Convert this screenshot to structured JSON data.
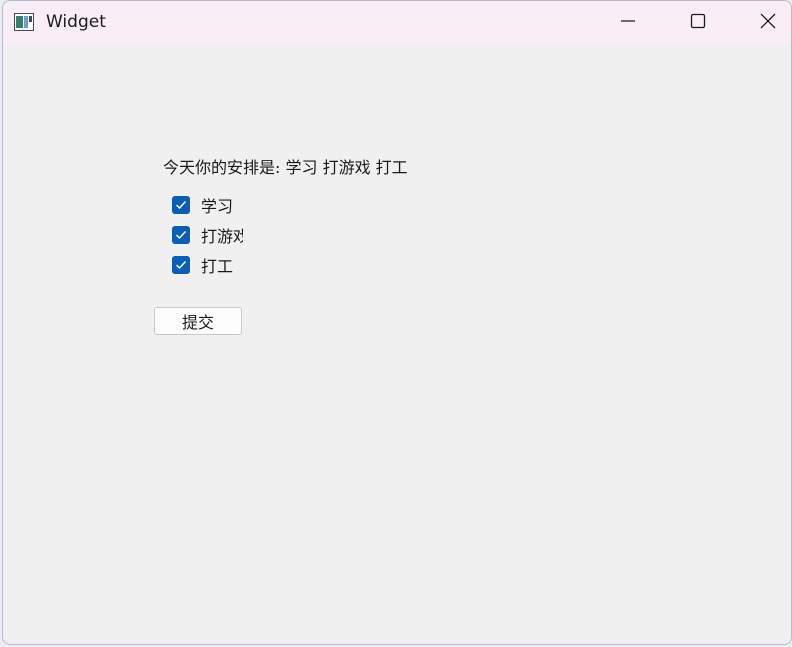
{
  "window": {
    "title": "Widget",
    "controls": {
      "minimize": "minimize-icon",
      "maximize": "maximize-icon",
      "close": "close-icon"
    }
  },
  "main": {
    "status_text": "今天你的安排是: 学习 打游戏 打工",
    "checkboxes": [
      {
        "label": "学习",
        "checked": true
      },
      {
        "label": "打游戏",
        "checked": true
      },
      {
        "label": "打工",
        "checked": true
      }
    ],
    "submit_label": "提交"
  },
  "colors": {
    "accent": "#0a5fb4",
    "titlebar": "#f9eef5",
    "background": "#f0f0f0"
  }
}
